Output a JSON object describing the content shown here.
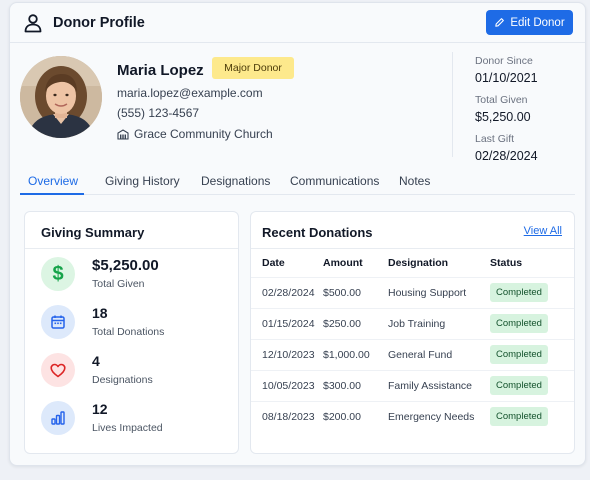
{
  "header": {
    "title": "Donor Profile",
    "edit_label": "Edit Donor"
  },
  "profile": {
    "name": "Maria Lopez",
    "badge": "Major Donor",
    "email": "maria.lopez@example.com",
    "phone": "(555) 123-4567",
    "church": "Grace Community Church"
  },
  "stats": [
    {
      "label": "Donor Since",
      "value": "01/10/2021"
    },
    {
      "label": "Total Given",
      "value": "$5,250.00"
    },
    {
      "label": "Last Gift",
      "value": "02/28/2024"
    }
  ],
  "tabs": [
    {
      "label": "Overview",
      "active": true
    },
    {
      "label": "Giving History",
      "active": false
    },
    {
      "label": "Designations",
      "active": false
    },
    {
      "label": "Communications",
      "active": false
    },
    {
      "label": "Notes",
      "active": false
    }
  ],
  "summary": {
    "title": "Giving Summary",
    "items": [
      {
        "value": "$5,250.00",
        "label": "Total Given",
        "icon": "dollar-icon",
        "color": "#16a34a",
        "bg": "#dcf5e3"
      },
      {
        "value": "18",
        "label": "Total Donations",
        "icon": "calendar-icon",
        "color": "#2563eb",
        "bg": "#dde9fb"
      },
      {
        "value": "4",
        "label": "Designations",
        "icon": "heart-icon",
        "color": "#dc2626",
        "bg": "#fde3e3"
      },
      {
        "value": "12",
        "label": "Lives Impacted",
        "icon": "bar-chart-icon",
        "color": "#2563eb",
        "bg": "#dde9fb"
      }
    ]
  },
  "donations": {
    "title": "Recent Donations",
    "view_all": "View All",
    "columns": [
      "Date",
      "Amount",
      "Designation",
      "Status"
    ],
    "rows": [
      {
        "date": "02/28/2024",
        "amount": "$500.00",
        "designation": "Housing Support",
        "status": "Completed"
      },
      {
        "date": "01/15/2024",
        "amount": "$250.00",
        "designation": "Job Training",
        "status": "Completed"
      },
      {
        "date": "12/10/2023",
        "amount": "$1,000.00",
        "designation": "General Fund",
        "status": "Completed"
      },
      {
        "date": "10/05/2023",
        "amount": "$300.00",
        "designation": "Family Assistance",
        "status": "Completed"
      },
      {
        "date": "08/18/2023",
        "amount": "$200.00",
        "designation": "Emergency Needs",
        "status": "Completed"
      }
    ]
  }
}
